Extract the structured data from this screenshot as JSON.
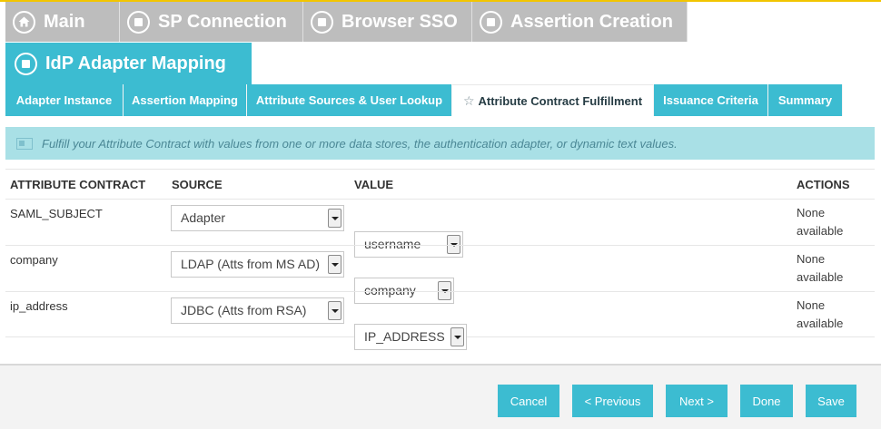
{
  "nav": {
    "tabs": [
      {
        "label": "Main",
        "icon": "home-icon"
      },
      {
        "label": "SP Connection",
        "icon": "stop-circle-icon"
      },
      {
        "label": "Browser SSO",
        "icon": "stop-circle-icon"
      },
      {
        "label": "Assertion Creation",
        "icon": "stop-circle-icon"
      }
    ],
    "active_subtab": {
      "label": "IdP Adapter Mapping",
      "icon": "stop-circle-icon"
    }
  },
  "page_tabs": [
    {
      "label": "Adapter Instance"
    },
    {
      "label": "Assertion Mapping"
    },
    {
      "label": "Attribute Sources & User Lookup"
    },
    {
      "label": "Attribute Contract Fulfillment",
      "active": true,
      "icon": "star-icon"
    },
    {
      "label": "Issuance Criteria"
    },
    {
      "label": "Summary"
    }
  ],
  "info_text": "Fulfill your Attribute Contract with values from one or more data stores, the authentication adapter, or dynamic text values.",
  "table": {
    "headers": {
      "attribute": "ATTRIBUTE CONTRACT",
      "source": "SOURCE",
      "value": "VALUE",
      "actions": "ACTIONS"
    },
    "rows": [
      {
        "attribute": "SAML_SUBJECT",
        "source": "Adapter",
        "value": "username",
        "actions_line1": "None",
        "actions_line2": "available"
      },
      {
        "attribute": "company",
        "source": "LDAP (Atts from MS AD)",
        "value": "company",
        "actions_line1": "None",
        "actions_line2": "available"
      },
      {
        "attribute": "ip_address",
        "source": "JDBC (Atts from RSA)",
        "value": "IP_ADDRESS",
        "actions_line1": "None",
        "actions_line2": "available"
      }
    ]
  },
  "buttons": {
    "cancel": "Cancel",
    "previous": "< Previous",
    "next": "Next >",
    "done": "Done",
    "save": "Save"
  },
  "colors": {
    "accent": "#3cbcd1",
    "nav_inactive": "#bdbdbd",
    "info_bg": "#a9e0e6",
    "top_line": "#f2c500"
  }
}
